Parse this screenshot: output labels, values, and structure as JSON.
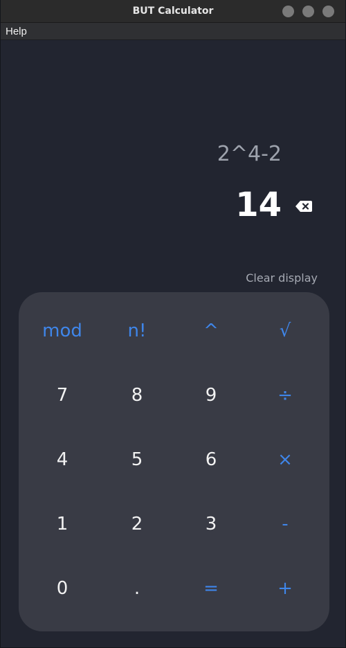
{
  "window": {
    "title": "BUT Calculator"
  },
  "menu": {
    "help": "Help"
  },
  "display": {
    "expression": "2^4-2",
    "result": "14",
    "clear_label": "Clear display"
  },
  "colors": {
    "accent": "#3f86ea",
    "background": "#222530",
    "keypad": "#393b45"
  },
  "keys": {
    "mod": "mod",
    "factorial": "n!",
    "power": "^",
    "sqrt": "√",
    "d7": "7",
    "d8": "8",
    "d9": "9",
    "divide": "÷",
    "d4": "4",
    "d5": "5",
    "d6": "6",
    "multiply": "×",
    "d1": "1",
    "d2": "2",
    "d3": "3",
    "minus": "-",
    "d0": "0",
    "dot": ".",
    "equals": "=",
    "plus": "+"
  }
}
